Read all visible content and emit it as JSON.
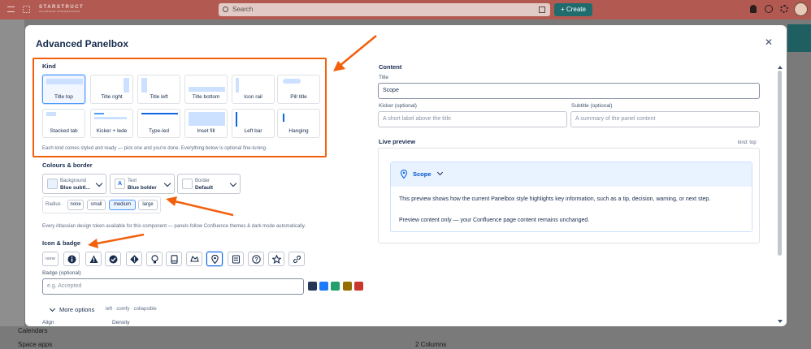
{
  "app": {
    "logo": "STARSTRUCT",
    "logo_sub": "ATLASSIAN INTEGRATIONS",
    "search_placeholder": "Search",
    "create_label": "Create",
    "sidebar_items": [
      "Calendars",
      "Space apps"
    ],
    "toolbar_columns": "2 Columns"
  },
  "modal": {
    "title": "Advanced Panelbox",
    "kind": {
      "heading": "Kind",
      "options": [
        "Title top",
        "Title right",
        "Title left",
        "Title bottom",
        "Icon rail",
        "Pill title",
        "Stacked tab",
        "Kicker + lede",
        "Type-led",
        "Inset fill",
        "Left bar",
        "Hanging"
      ],
      "selected": "Title top",
      "help": "Each kind comes styled and ready — pick one and you're done. Everything below is optional fine-tuning."
    },
    "colours": {
      "heading": "Colours & border",
      "background_label": "Background",
      "background_value": "Blue subtl...",
      "text_label": "Text",
      "text_value": "Blue bolder",
      "text_icon": "A",
      "border_label": "Border",
      "border_value": "Default",
      "radius_label": "Radius",
      "radius_options": [
        "none",
        "small",
        "medium",
        "large"
      ],
      "radius_selected": "medium",
      "help": "Every Atlassian design token available for this component — panels follow Confluence themes & dark mode automatically."
    },
    "icon_badge": {
      "heading": "Icon & badge",
      "icon_options": [
        "none",
        "info-icon",
        "warning-icon",
        "check-icon",
        "error-icon",
        "lightbulb-icon",
        "book-icon",
        "hat-icon",
        "pin-icon",
        "note-icon",
        "question-icon",
        "star-icon",
        "link-icon"
      ],
      "selected_icon": "pin-icon",
      "badge_label": "Badge (optional)",
      "badge_placeholder": "e.g. Accepted",
      "badge_colors": [
        "#253858",
        "#1d7afc",
        "#22a06b",
        "#946f00",
        "#c9372c"
      ]
    },
    "more": {
      "label": "More options",
      "summary": "left · comfy · collapsible",
      "align_label": "Align",
      "density_label": "Density"
    },
    "content": {
      "heading": "Content",
      "title_label": "Title",
      "title_value": "Scope",
      "kicker_label": "Kicker (optional)",
      "kicker_placeholder": "A short label above the title",
      "subtitle_label": "Subtitle (optional)",
      "subtitle_placeholder": "A summary of the panel content"
    },
    "preview": {
      "heading": "Live preview",
      "kind_tag": "kind: top",
      "panel_title": "Scope",
      "body_1": "This preview shows how the current Panelbox style highlights key information, such as a tip, decision, warning, or next step.",
      "body_2": "Preview content only — your Confluence page content remains unchanged."
    }
  },
  "colors": {
    "accent": "#0c66e4",
    "highlight": "#f2600c",
    "top_bar": "#b25a52",
    "create_button": "#1f6b6d"
  }
}
